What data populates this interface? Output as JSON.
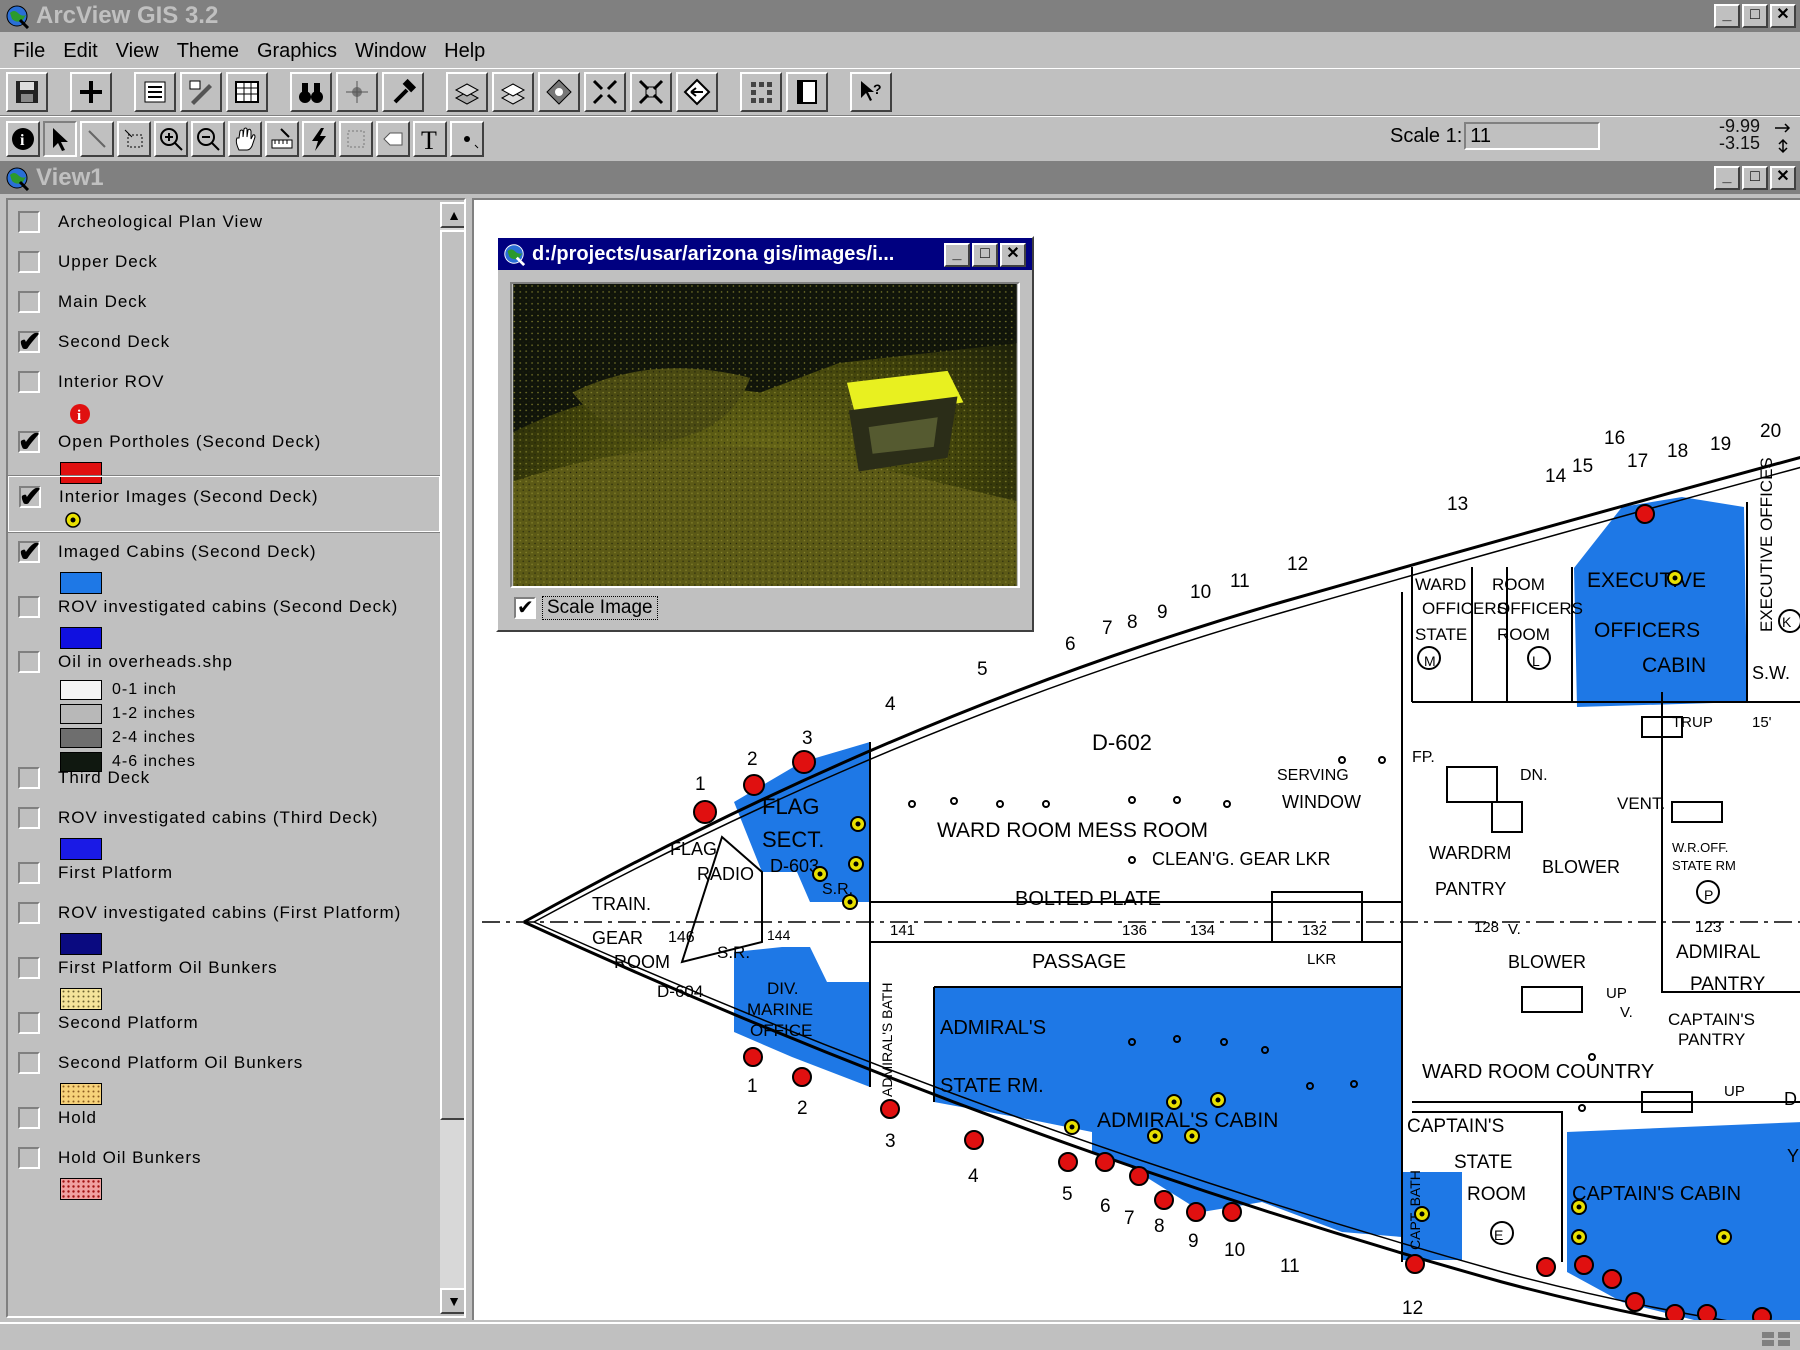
{
  "app": {
    "title": "ArcView GIS 3.2"
  },
  "menu": [
    "File",
    "Edit",
    "View",
    "Theme",
    "Graphics",
    "Window",
    "Help"
  ],
  "toolbar": {
    "buttons": [
      "save-project",
      "add-theme",
      "theme-properties",
      "edit-legend",
      "open-theme-table",
      "find",
      "locate-address",
      "query-builder",
      "select-by-theme",
      "clear-selected",
      "zoom-to-full-extent",
      "zoom-to-themes",
      "zoom-to-selected",
      "zoom-in",
      "zoom-out",
      "zoom-previous",
      "layout",
      "print",
      "help"
    ],
    "tools": [
      "identify",
      "pointer",
      "vertex-edit",
      "select-feature",
      "zoom-in",
      "zoom-out",
      "pan",
      "measure",
      "hotlink",
      "area-of-interest",
      "label",
      "text",
      "draw-point"
    ]
  },
  "scale": {
    "label": "Scale 1:",
    "value": "11"
  },
  "coords": {
    "x": "-9.99",
    "y": "-3.15"
  },
  "view": {
    "title": "View1"
  },
  "toc": {
    "items": [
      {
        "name": "Archeological Plan View",
        "checked": false
      },
      {
        "name": "Upper Deck",
        "checked": false
      },
      {
        "name": "Main Deck",
        "checked": false
      },
      {
        "name": "Second Deck",
        "checked": true
      },
      {
        "name": "Interior ROV",
        "checked": false
      },
      {
        "name": "Open Portholes (Second Deck)",
        "checked": true
      },
      {
        "name": "Interior Images (Second Deck)",
        "checked": true
      },
      {
        "name": "Imaged Cabins (Second Deck)",
        "checked": true
      },
      {
        "name": "ROV investigated cabins (Second Deck)",
        "checked": false
      },
      {
        "name": "Oil in overheads.shp",
        "checked": false
      },
      {
        "name": "Third Deck",
        "checked": false
      },
      {
        "name": "ROV investigated cabins (Third Deck)",
        "checked": false
      },
      {
        "name": "First Platform",
        "checked": false
      },
      {
        "name": "ROV investigated cabins (First Platform)",
        "checked": false
      },
      {
        "name": "First Platform Oil Bunkers",
        "checked": false
      },
      {
        "name": "Second Platform",
        "checked": false
      },
      {
        "name": "Second Platform Oil Bunkers",
        "checked": false
      },
      {
        "name": "Hold",
        "checked": false
      },
      {
        "name": "Hold Oil Bunkers",
        "checked": false
      }
    ],
    "oil_legend": [
      {
        "label": "0-1 inch",
        "color": "#f4f4f4"
      },
      {
        "label": "1-2 inches",
        "color": "#b8b8b8"
      },
      {
        "label": "2-4 inches",
        "color": "#6e6e6e"
      },
      {
        "label": "4-6 inches",
        "color": "#101810"
      }
    ]
  },
  "colors": {
    "porthole": "#e01010",
    "imaged_cabin": "#1e78e6",
    "rov_second": "#1010e0",
    "rov_third": "#1a1ae6",
    "rov_first": "#0a0a80",
    "image_point": "#e8e000"
  },
  "image_window": {
    "title": "d:/projects/usar/arizona gis/images/i...",
    "scale_image_label": "Scale Image",
    "scale_image_checked": true
  },
  "map": {
    "section_labels": [
      "1",
      "2",
      "3",
      "4",
      "5",
      "6",
      "7",
      "8",
      "9",
      "10",
      "11",
      "12",
      "13",
      "14",
      "15",
      "16",
      "17",
      "18",
      "19",
      "20"
    ],
    "rooms": {
      "flag_sect": [
        "FLAG",
        "SECT.",
        "D-603",
        "S.R."
      ],
      "flag_radio": [
        "FLAG",
        "RADIO"
      ],
      "train_gear": [
        "TRAIN.",
        "GEAR",
        "ROOM"
      ],
      "train_frame": "146",
      "train_deck_code": "D-604",
      "sr": "S.R.",
      "sr_frame": "144",
      "div_marine": [
        "DIV.",
        "MARINE",
        "OFFICE"
      ],
      "admirals_bath": "ADMIRAL'S BATH",
      "admirals_stateroom": [
        "ADMIRAL'S",
        "STATE RM."
      ],
      "admirals_cabin": "ADMIRAL'S CABIN",
      "deck_code": "D-602",
      "ward_room_mess": "WARD ROOM MESS ROOM",
      "serving_window": [
        "SERVING",
        "WINDOW"
      ],
      "cleaning_gear": "CLEAN'G. GEAR LKR",
      "bolted_plate": "BOLTED PLATE",
      "passage": "PASSAGE",
      "lkr": "LKR",
      "frames": [
        "141",
        "136",
        "134",
        "132",
        "128",
        "123"
      ],
      "ward_officers_state": [
        "WARD",
        "OFFICERS",
        "STATE"
      ],
      "room_officers": [
        "ROOM",
        "OFFICERS",
        "ROOM"
      ],
      "mark_m": "M",
      "mark_l": "L",
      "mark_e": "E",
      "mark_p": "P",
      "executive_officers_cabin": [
        "EXECUTIVE",
        "OFFICERS",
        "CABIN"
      ],
      "executive_offices": "EXECUTIVE OFFICES",
      "mark_k": "K",
      "sw": "S.W.",
      "trup": "TRUP",
      "trup_val": "15'",
      "dn": "DN.",
      "fp": "FP.",
      "wardrm_pantry": [
        "WARDRM",
        "PANTRY"
      ],
      "vent": "VENT.",
      "blower": "BLOWER",
      "v": "V.",
      "up": "UP",
      "wr_off_state": [
        "W.R.OFF.",
        "STATE RM"
      ],
      "admiral_pantry": [
        "ADMIRAL",
        "PANTRY"
      ],
      "captains_pantry": [
        "CAPTAIN'S",
        "PANTRY"
      ],
      "ward_room_country": "WARD ROOM COUNTRY",
      "captains_stateroom": [
        "CAPTAIN'S",
        "STATE",
        "ROOM"
      ],
      "capt_bath": "CAPT. BATH",
      "captains_cabin": "CAPTAIN'S CABIN",
      "cut_d": "D",
      "cut_y": "Y"
    }
  }
}
